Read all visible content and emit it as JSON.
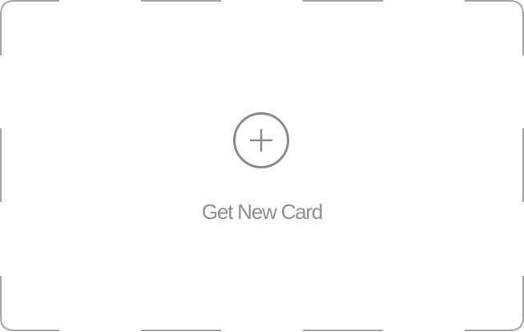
{
  "card": {
    "label": "Get New Card",
    "icon": "plus-circle-icon"
  },
  "colors": {
    "border": "#a3a3a3",
    "icon": "#8a8a8a",
    "label": "#8e8e8e",
    "background": "#ffffff"
  }
}
